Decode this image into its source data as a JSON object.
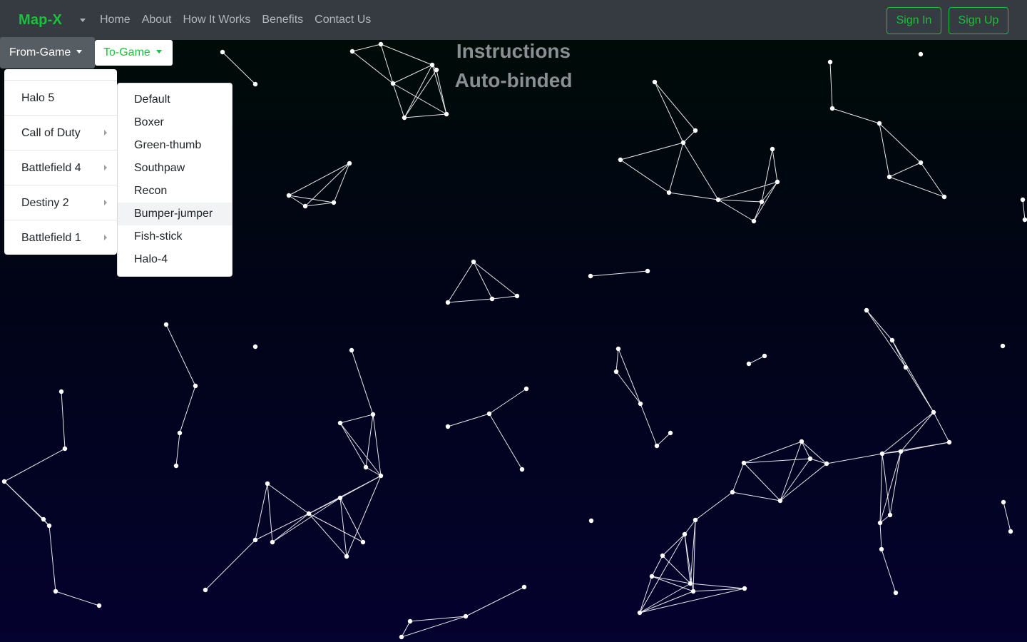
{
  "navbar": {
    "brand": "Map-X",
    "links": [
      "Home",
      "About",
      "How It Works",
      "Benefits",
      "Contact Us"
    ],
    "sign_in": "Sign In",
    "sign_up": "Sign Up"
  },
  "controls": {
    "from_game_label": "From-Game",
    "to_game_label": "To-Game"
  },
  "from_menu": {
    "items": [
      {
        "label": "Halo 5",
        "has_submenu": false
      },
      {
        "label": "Call of Duty",
        "has_submenu": true
      },
      {
        "label": "Battlefield 4",
        "has_submenu": true
      },
      {
        "label": "Destiny 2",
        "has_submenu": true
      },
      {
        "label": "Battlefield 1",
        "has_submenu": true
      }
    ]
  },
  "to_menu": {
    "items": [
      "Default",
      "Boxer",
      "Green-thumb",
      "Southpaw",
      "Recon",
      "Bumper-jumper",
      "Fish-stick",
      "Halo-4"
    ],
    "highlighted": "Bumper-jumper"
  },
  "main": {
    "heading_1": "Instructions",
    "heading_2": "Auto-binded"
  },
  "colors": {
    "brand": "#19c23a",
    "navbar_bg": "#353b41",
    "node": "#ffffff"
  }
}
